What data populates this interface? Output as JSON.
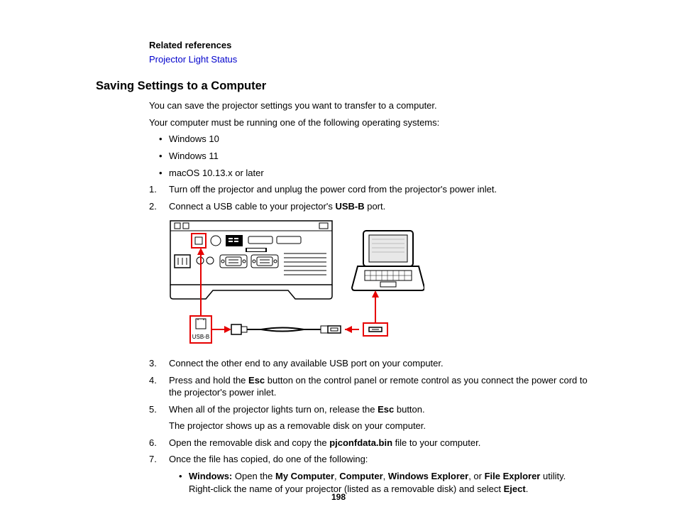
{
  "related": {
    "heading": "Related references",
    "link": "Projector Light Status"
  },
  "section": {
    "heading": "Saving Settings to a Computer",
    "intro1": "You can save the projector settings you want to transfer to a computer.",
    "intro2": "Your computer must be running one of the following operating systems:",
    "os": [
      "Windows 10",
      "Windows 11",
      "macOS 10.13.x or later"
    ],
    "steps": {
      "s1": "Turn off the projector and unplug the power cord from the projector's power inlet.",
      "s2_pre": "Connect a USB cable to your projector's ",
      "s2_bold": "USB-B",
      "s2_post": " port.",
      "s3": "Connect the other end to any available USB port on your computer.",
      "s4_pre": "Press and hold the ",
      "s4_bold": "Esc",
      "s4_post": " button on the control panel or remote control as you connect the power cord to the projector's power inlet.",
      "s5_pre": "When all of the projector lights turn on, release the ",
      "s5_bold": "Esc",
      "s5_post": " button.",
      "s5_cont": "The projector shows up as a removable disk on your computer.",
      "s6_pre": "Open the removable disk and copy the ",
      "s6_bold": "pjconfdata.bin",
      "s6_post": " file to your computer.",
      "s7": "Once the file has copied, do one of the following:",
      "s7_sub": {
        "win_label": "Windows:",
        "win_pre": " Open the ",
        "win_b1": "My Computer",
        "win_sep1": ", ",
        "win_b2": "Computer",
        "win_sep2": ", ",
        "win_b3": "Windows Explorer",
        "win_sep3": ", or ",
        "win_b4": "File Explorer",
        "win_post": " utility. Right-click the name of your projector (listed as a removable disk) and select ",
        "win_b5": "Eject",
        "win_end": "."
      }
    }
  },
  "figure": {
    "usb_b_label": "USB-B"
  },
  "page_number": "198"
}
